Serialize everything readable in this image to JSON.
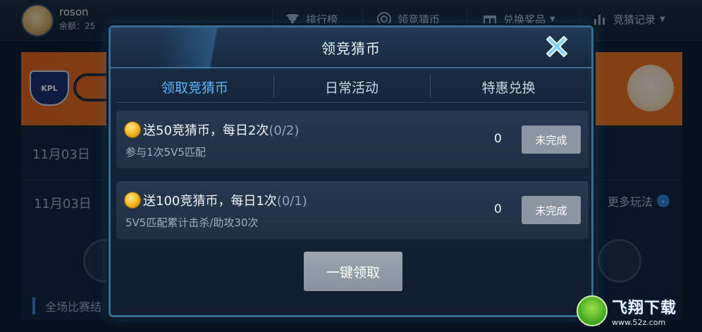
{
  "user": {
    "name": "roson",
    "balance_label": "余额：25"
  },
  "nav": {
    "leaderboard": "排行榜",
    "betting_coins": "领竞猜币",
    "redeem_prizes": "兑换奖品",
    "bet_history": "竞猜记录"
  },
  "background": {
    "banner_logo_text": "KPL",
    "dates": [
      "11月03日",
      "11月03日"
    ],
    "more_play": "更多玩法",
    "all_matches": "全场比赛结"
  },
  "modal": {
    "title": "领竞猜币",
    "tabs": [
      "领取竞猜币",
      "日常活动",
      "特惠兑换"
    ],
    "active_tab": 0,
    "tasks": [
      {
        "title": "送50竞猜币，每日2次",
        "progress": "(0/2)",
        "description": "参与1次5V5匹配",
        "count": "0",
        "status": "未完成"
      },
      {
        "title": "送100竞猜币，每日1次",
        "progress": "(0/1)",
        "description": "5V5匹配累计击杀/助攻30次",
        "count": "0",
        "status": "未完成"
      }
    ],
    "claim_all_label": "一键领取"
  },
  "watermark": {
    "name": "飞翔下载",
    "url": "www.52z.com"
  },
  "colors": {
    "accent": "#5fb6ff",
    "button_gray": "#8a96a2",
    "banner_orange": "#ee6f18",
    "coin": "#f1b11f"
  },
  "icons": {
    "close": "close-x-icon",
    "coin": "coin-icon",
    "leaderboard": "trophy-icon",
    "betting_coins": "target-icon",
    "redeem_prizes": "gift-icon",
    "bet_history": "bar-chart-icon"
  }
}
